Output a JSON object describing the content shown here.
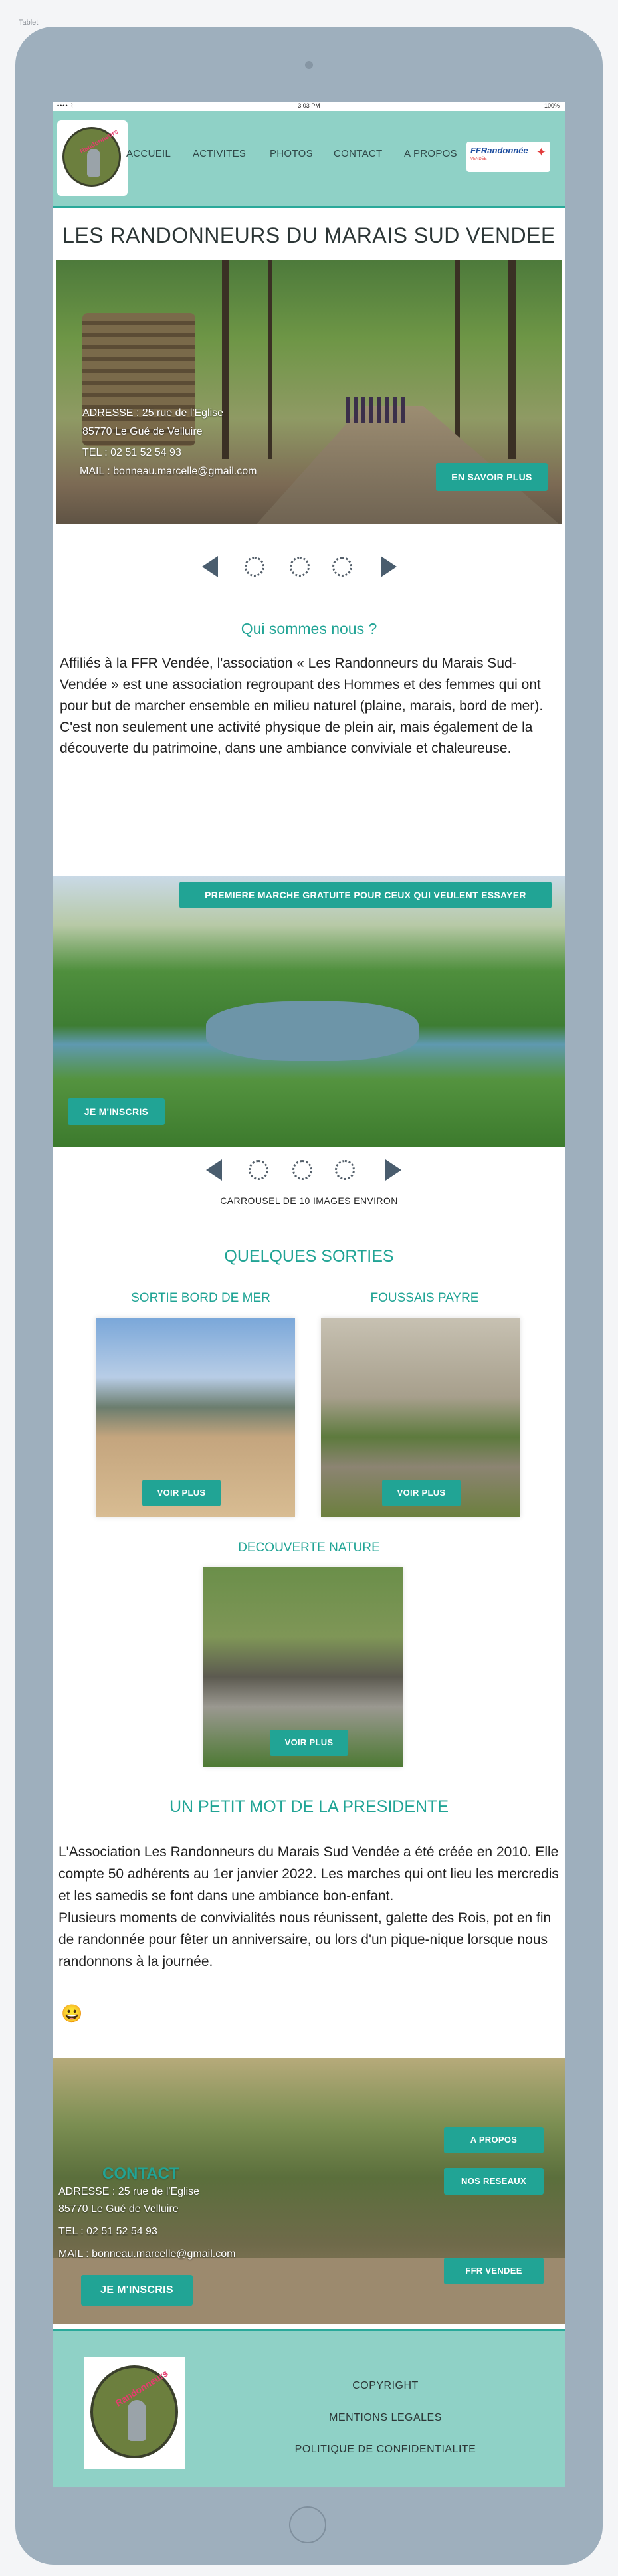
{
  "device_label": "Tablet",
  "status_bar": {
    "signal": "•••• ⌇",
    "time": "3:03 PM",
    "battery": "100%"
  },
  "nav": {
    "logo_text": "Randonneurs",
    "items": [
      "ACCUEIL",
      "ACTIVITES",
      "PHOTOS",
      "CONTACT",
      "A PROPOS"
    ],
    "partner_logo": {
      "name": "FFRandonnée",
      "sub": "VENDÉE"
    }
  },
  "page_title": "LES RANDONNEURS DU MARAIS SUD VENDEE",
  "hero": {
    "address_line1": "ADRESSE :  25 rue de   l'Eglise",
    "address_line2": "85770 Le Gué de Velluire",
    "phone": "TEL : 02 51 52 54 93",
    "mail": "MAIL : bonneau.marcelle@gmail.com",
    "cta": "EN SAVOIR PLUS"
  },
  "about": {
    "heading": "Qui sommes nous ?",
    "text": "Affiliés à la FFR Vendée, l'association « Les Randonneurs du Marais Sud-Vendée » est une association regroupant des Hommes et des femmes qui ont pour but de marcher ensemble en milieu naturel (plaine, marais, bord de mer). C'est non seulement une activité physique de plein air, mais également de la découverte du patrimoine, dans une ambiance conviviale et chaleureuse."
  },
  "promo": {
    "banner": "PREMIERE MARCHE GRATUITE POUR CEUX QUI VEULENT ESSAYER",
    "cta": "JE M'INSCRIS",
    "carousel_caption": "CARROUSEL DE 10 IMAGES ENVIRON"
  },
  "outings": {
    "heading": "QUELQUES SORTIES",
    "cards": [
      {
        "title": "SORTIE BORD DE MER",
        "button": "VOIR PLUS"
      },
      {
        "title": "FOUSSAIS PAYRE",
        "button": "VOIR PLUS"
      },
      {
        "title": "DECOUVERTE NATURE",
        "button": "VOIR PLUS"
      }
    ]
  },
  "president": {
    "heading": "UN PETIT MOT DE LA PRESIDENTE",
    "text": "L'Association Les Randonneurs du Marais Sud Vendée a été créée en 2010. Elle compte 50 adhérents au 1er janvier 2022. Les marches qui ont lieu les mercredis et les samedis se font dans une ambiance bon-enfant.\nPlusieurs moments de convivialités nous réunissent, galette des Rois, pot en fin de randonnée pour fêter un anniversaire, ou lors d'un pique-nique lorsque nous randonnons à la journée.",
    "emoji": "😀"
  },
  "contact": {
    "heading": "CONTACT",
    "address_line1": "ADRESSE :  25 rue de l'Eglise",
    "address_line2": "85770 Le Gué de Velluire",
    "phone": "TEL : 02 51 52 54 93",
    "mail": "MAIL : bonneau.marcelle@gmail.com",
    "cta": "JE M'INSCRIS",
    "side_buttons": [
      "A PROPOS",
      "NOS RESEAUX",
      "FFR VENDEE"
    ]
  },
  "footer": {
    "links": [
      "COPYRIGHT",
      "MENTIONS LEGALES",
      "POLITIQUE DE CONFIDENTIALITE"
    ]
  },
  "colors": {
    "teal": "#21a495",
    "mint": "#8fd1c6",
    "frame": "#9eafbd"
  }
}
